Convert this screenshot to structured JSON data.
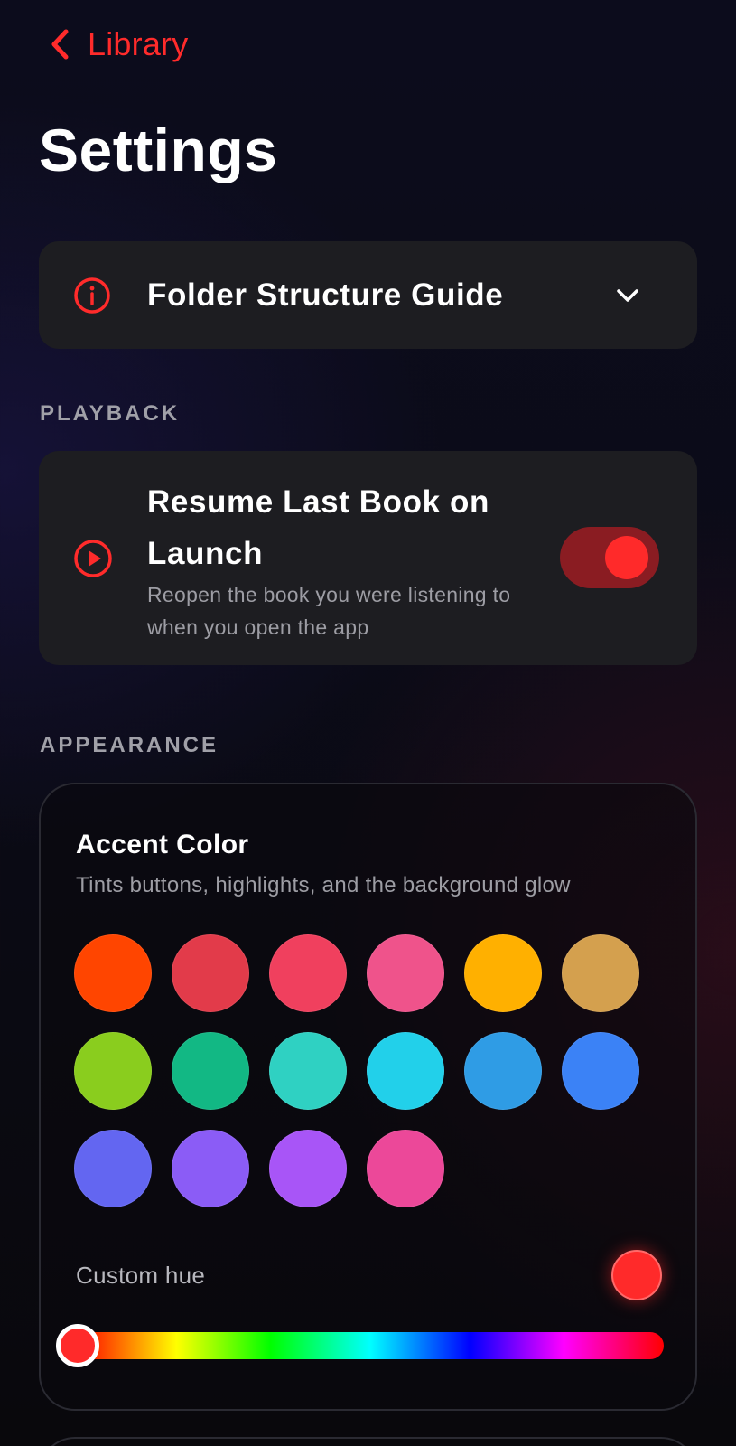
{
  "nav": {
    "back_label": "Library"
  },
  "page": {
    "title": "Settings"
  },
  "guide": {
    "title": "Folder Structure Guide"
  },
  "playback": {
    "section_label": "PLAYBACK",
    "resume": {
      "title": "Resume Last Book on Launch",
      "subtitle": "Reopen the book you were listening to when you open the app",
      "enabled": true
    }
  },
  "appearance": {
    "section_label": "APPEARANCE",
    "accent": {
      "title": "Accent Color",
      "subtitle": "Tints buttons, highlights, and the background glow",
      "swatches": [
        "#ff4500",
        "#e23b4a",
        "#f0405e",
        "#ef538b",
        "#ffb000",
        "#d4a04e",
        "#8acd1e",
        "#12b884",
        "#2fd1c2",
        "#22d0ea",
        "#2f9ce5",
        "#3b82f6",
        "#6366f1",
        "#8b5cf6",
        "#a855f7",
        "#ec4899"
      ],
      "custom_hue_label": "Custom hue",
      "custom_hue_color": "#ff2a2a",
      "custom_hue_value": 0
    }
  },
  "colors": {
    "accent": "#ff2b2b",
    "background": "#0b0b14",
    "card": "#1d1d21"
  }
}
